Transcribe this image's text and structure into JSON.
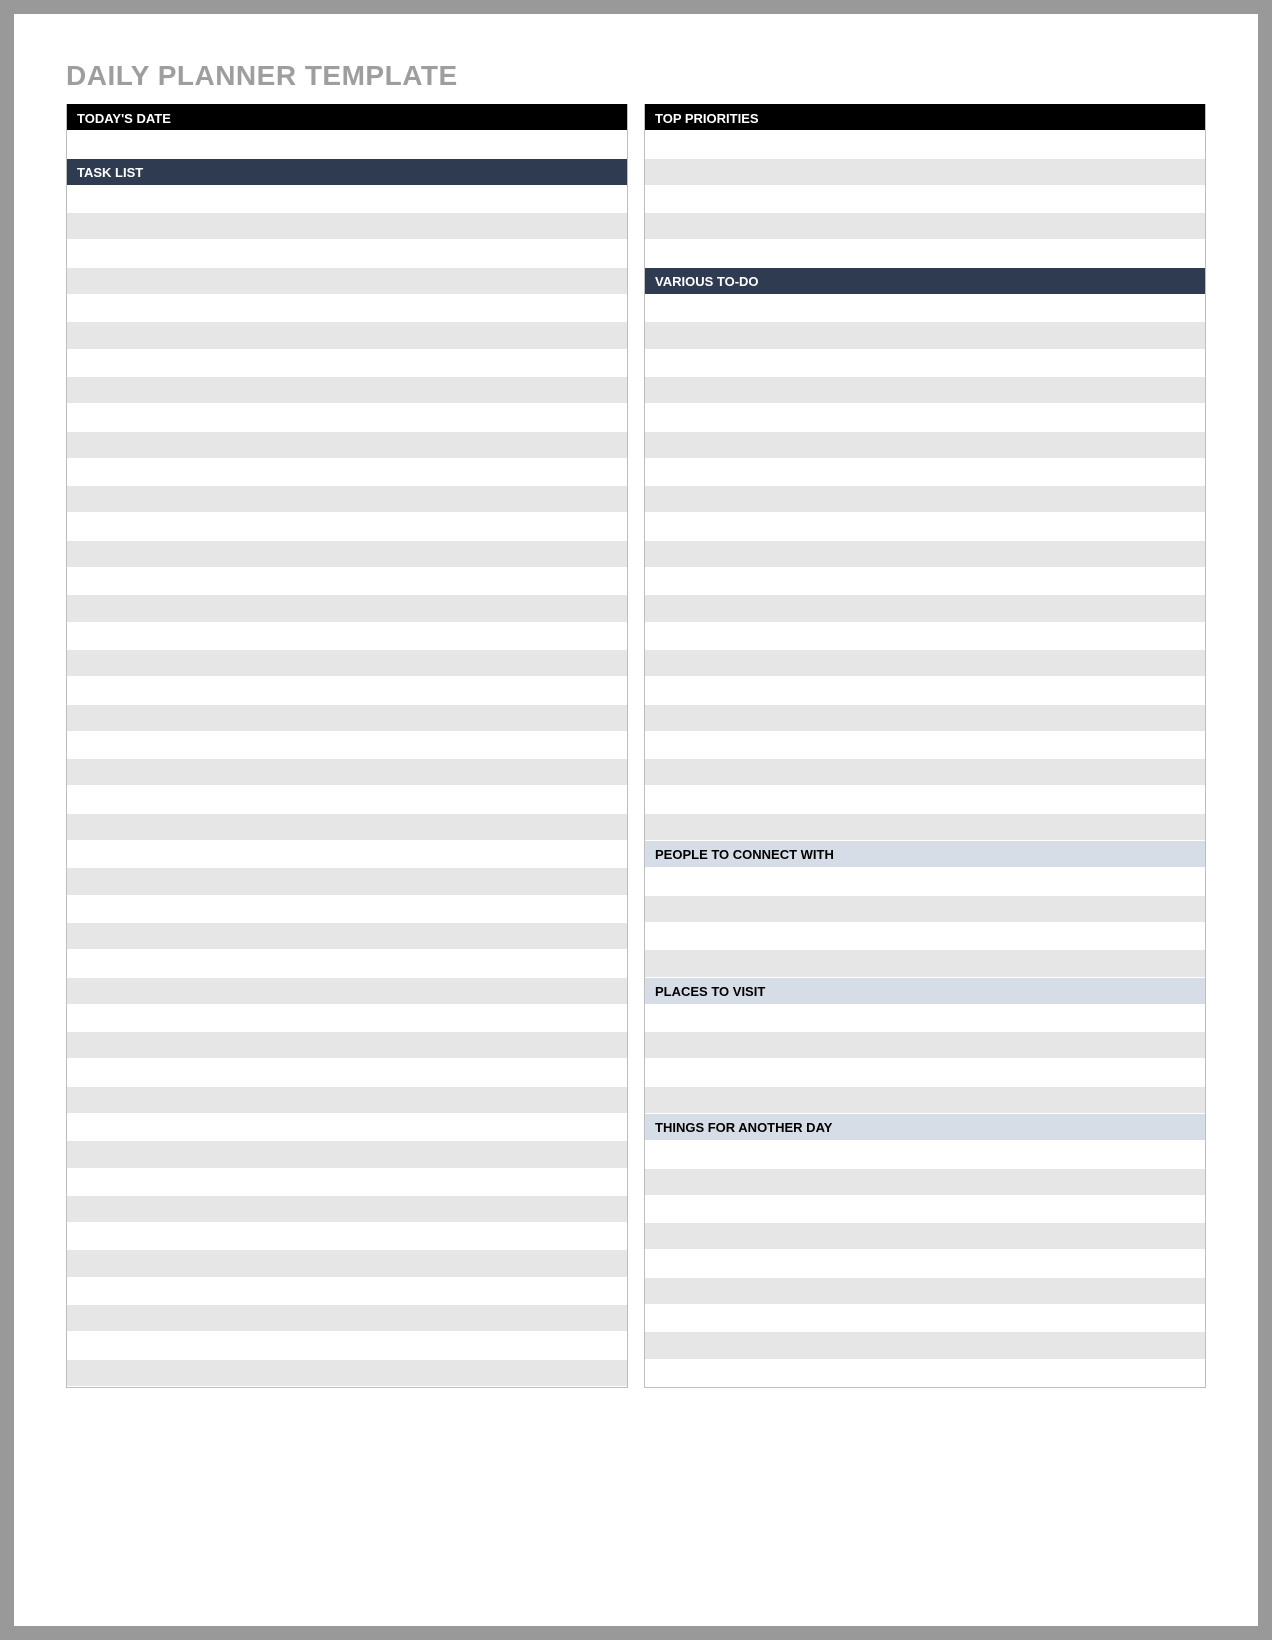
{
  "title": "DAILY PLANNER TEMPLATE",
  "left": {
    "todays_date": "TODAY'S DATE",
    "task_list": "TASK LIST"
  },
  "right": {
    "top_priorities": "TOP PRIORITIES",
    "various_todo": "VARIOUS TO-DO",
    "people_connect": "PEOPLE TO CONNECT WITH",
    "places_visit": "PLACES TO VISIT",
    "things_another_day": "THINGS FOR ANOTHER DAY"
  }
}
